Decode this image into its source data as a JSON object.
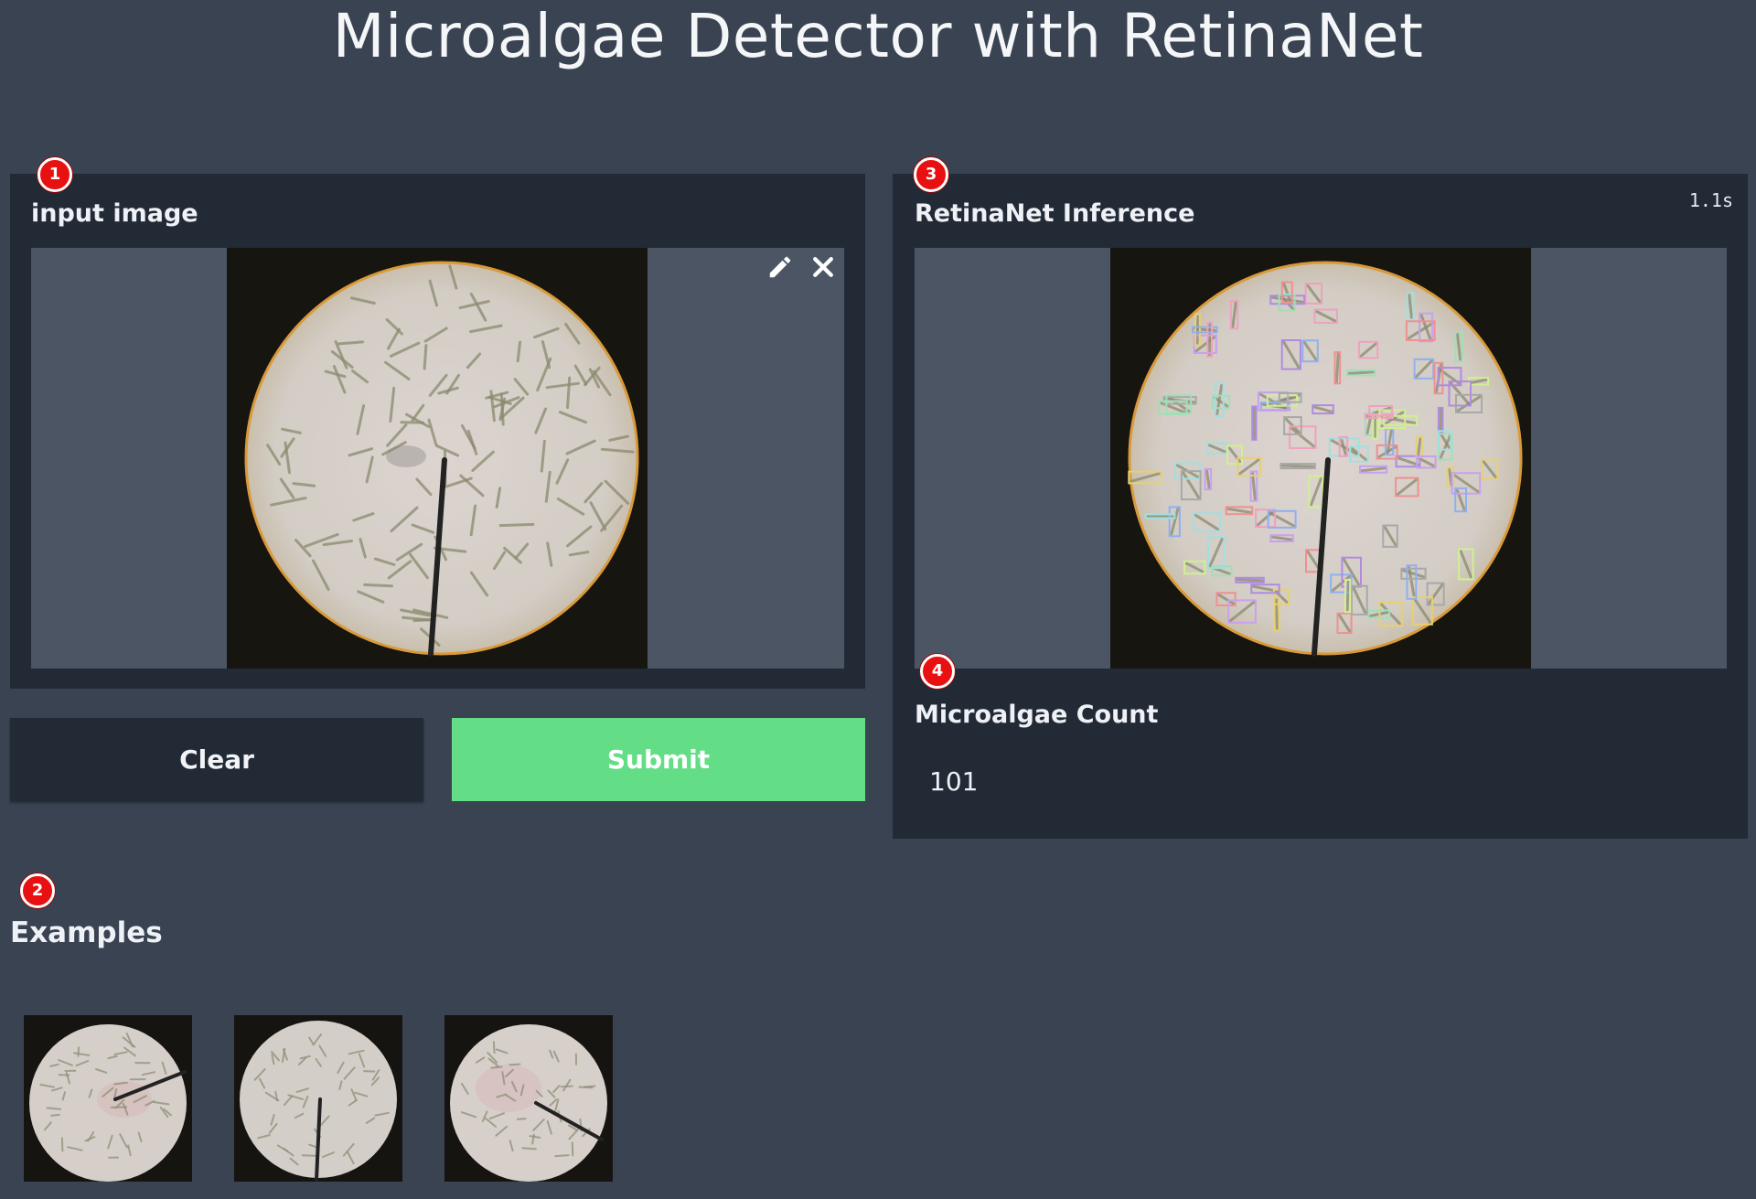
{
  "app": {
    "title": "Microalgae Detector with RetinaNet"
  },
  "input_panel": {
    "badge": "1",
    "label": "input image",
    "tools": {
      "edit_icon": "pencil-icon",
      "clear_icon": "close-icon"
    }
  },
  "buttons": {
    "clear": "Clear",
    "submit": "Submit"
  },
  "examples": {
    "badge": "2",
    "label": "Examples",
    "items": [
      {
        "name": "example-1"
      },
      {
        "name": "example-2"
      },
      {
        "name": "example-3"
      }
    ]
  },
  "output_panel": {
    "badge": "3",
    "label": "RetinaNet Inference",
    "timer": "1.1s"
  },
  "count_panel": {
    "badge": "4",
    "label": "Microalgae Count",
    "value": "101"
  },
  "colors": {
    "page_background": "#3a4352",
    "panel_background": "#222a36",
    "image_background": "#4b5563",
    "submit_green": "#63dd86",
    "badge_red": "#e81010"
  }
}
